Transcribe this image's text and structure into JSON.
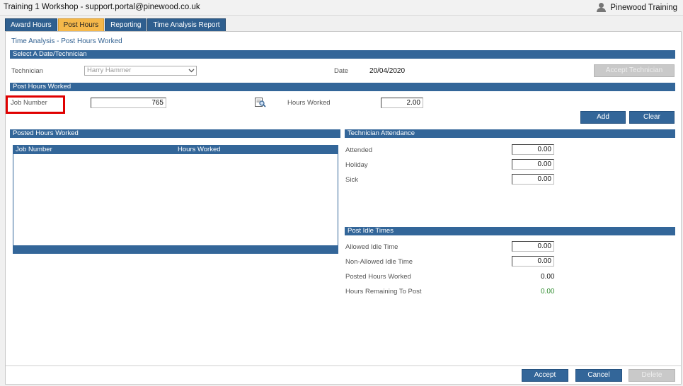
{
  "window": {
    "title": "Training 1 Workshop - support.portal@pinewood.co.uk",
    "user": "Pinewood Training",
    "user_icon": "user-icon"
  },
  "tabs": [
    {
      "label": "Award Hours",
      "active": false
    },
    {
      "label": "Post Hours",
      "active": true
    },
    {
      "label": "Reporting",
      "active": false
    },
    {
      "label": "Time Analysis Report",
      "active": false
    }
  ],
  "page": {
    "title": "Time Analysis - Post Hours Worked"
  },
  "select_section": {
    "header": "Select A Date/Technician",
    "technician_label": "Technician",
    "technician_value": "Harry Hammer",
    "date_label": "Date",
    "date_value": "20/04/2020",
    "accept_technician_label": "Accept Technician"
  },
  "post_section": {
    "header": "Post Hours Worked",
    "job_number_label": "Job Number",
    "job_number_value": "765",
    "hours_worked_label": "Hours Worked",
    "hours_worked_value": "2.00",
    "add_label": "Add",
    "clear_label": "Clear",
    "lookup_icon": "search-document-icon"
  },
  "posted_section": {
    "header": "Posted Hours Worked",
    "columns": [
      "Job Number",
      "Hours Worked"
    ],
    "rows": []
  },
  "attendance_section": {
    "header": "Technician Attendance",
    "attended_label": "Attended",
    "attended_value": "0.00",
    "holiday_label": "Holiday",
    "holiday_value": "0.00",
    "sick_label": "Sick",
    "sick_value": "0.00"
  },
  "idle_section": {
    "header": "Post Idle Times",
    "allowed_label": "Allowed Idle Time",
    "allowed_value": "0.00",
    "non_allowed_label": "Non-Allowed Idle Time",
    "non_allowed_value": "0.00",
    "posted_label": "Posted Hours Worked",
    "posted_value": "0.00",
    "remaining_label": "Hours Remaining To Post",
    "remaining_value": "0.00"
  },
  "footer": {
    "accept_label": "Accept",
    "cancel_label": "Cancel",
    "delete_label": "Delete"
  },
  "colors": {
    "section_blue": "#336699",
    "active_tab": "#f5b84a",
    "highlight": "#e00000",
    "remaining_green": "#2e8b2e"
  }
}
